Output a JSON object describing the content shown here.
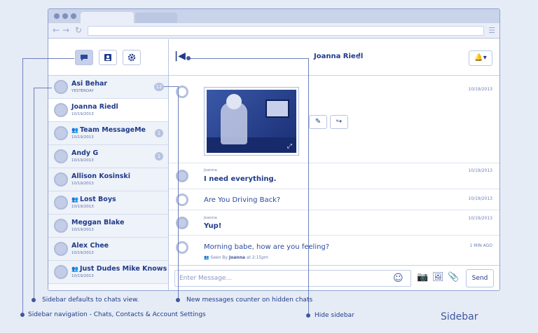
{
  "sidebar": {
    "nav": [
      {
        "name": "chats",
        "icon": "chat-bubble-icon"
      },
      {
        "name": "contacts",
        "icon": "contacts-icon"
      },
      {
        "name": "settings",
        "icon": "gear-icon"
      }
    ],
    "chats": [
      {
        "name": "Asi Behar",
        "date": "YESTERDAY",
        "badge": "12",
        "group": false
      },
      {
        "name": "Joanna Riedl",
        "date": "10/19/2013",
        "badge": "",
        "group": false
      },
      {
        "name": "Team MessageMe",
        "date": "10/19/2013",
        "badge": "1",
        "group": true
      },
      {
        "name": "Andy G",
        "date": "10/19/2013",
        "badge": "1",
        "group": false
      },
      {
        "name": "Allison Kosinski",
        "date": "10/19/2013",
        "badge": "",
        "group": false
      },
      {
        "name": "Lost Boys",
        "date": "10/19/2013",
        "badge": "",
        "group": true
      },
      {
        "name": "Meggan Blake",
        "date": "10/19/2013",
        "badge": "",
        "group": false
      },
      {
        "name": "Alex Chee",
        "date": "10/19/2013",
        "badge": "",
        "group": false
      },
      {
        "name": "Just Dudes Mike Knows",
        "date": "10/19/2013",
        "badge": "",
        "group": true
      }
    ]
  },
  "header": {
    "contact_name": "Joanna Riedl",
    "hide_icon": "hide-sidebar-icon",
    "bell_icon": "bell-icon"
  },
  "messages": [
    {
      "sender": "",
      "text": "",
      "time": "10/19/2013",
      "type": "photo"
    },
    {
      "sender": "Joanna",
      "text": "I need everything.",
      "time": "10/19/2013"
    },
    {
      "sender": "",
      "text": "Are You Driving Back?",
      "time": "10/19/2013"
    },
    {
      "sender": "Joanna",
      "text": "Yup!",
      "time": "10/19/2013"
    },
    {
      "sender": "",
      "text": "Morning babe, how are you feeling?",
      "time": "1 MIN AGO"
    }
  ],
  "seen": {
    "prefix": "Seen By",
    "name": "Joanna",
    "at": "at 2:15pm"
  },
  "composer": {
    "placeholder": "Enter Message...",
    "send_label": "Send"
  },
  "annotations": {
    "chats_view": "Sidebar defaults to chats view.",
    "nav": "Sidebar navigation - Chats, Contacts & Account Settings",
    "counter": "New messages counter on hidden chats",
    "hide": "Hide sidebar"
  },
  "caption": "Sidebar",
  "colors": {
    "accent": "#1f3a8a",
    "background": "#e6ecf6",
    "line": "#6d80bb"
  }
}
